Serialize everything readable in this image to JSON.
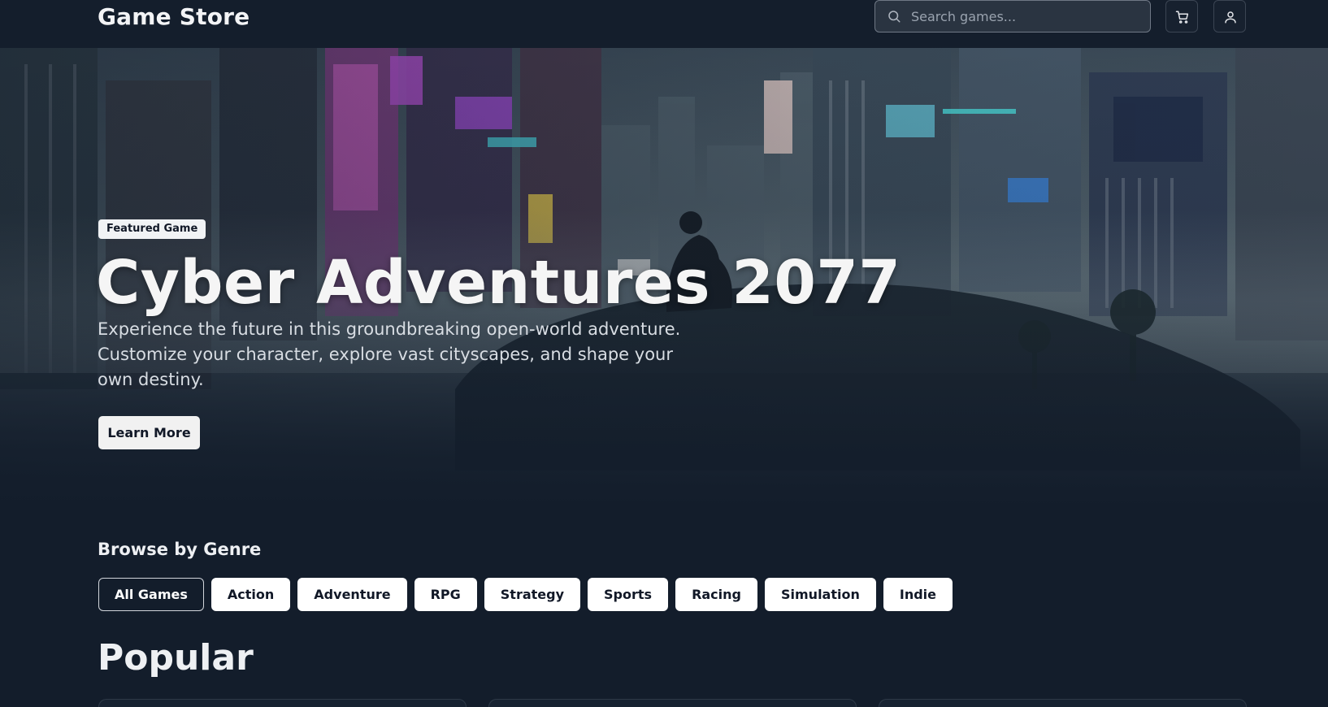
{
  "header": {
    "brand": "Game Store",
    "search_placeholder": "Search games...",
    "icons": [
      "search-icon",
      "cart-icon",
      "user-icon"
    ]
  },
  "hero": {
    "badge": "Featured Game",
    "title": "Cyber Adventures 2077",
    "description": "Experience the future in this groundbreaking open-world adventure. Customize your character, explore vast cityscapes, and shape your own destiny.",
    "button": "Learn More"
  },
  "genres": {
    "title": "Browse by Genre",
    "items": [
      "All Games",
      "Action",
      "Adventure",
      "RPG",
      "Strategy",
      "Sports",
      "Racing",
      "Simulation",
      "Indie"
    ],
    "active": "All Games"
  },
  "popular": {
    "title": "Popular"
  },
  "colors": {
    "background": "#131d2b",
    "header": "#141e2c",
    "chip": "#ffffff",
    "text": "#f1f3f6"
  }
}
